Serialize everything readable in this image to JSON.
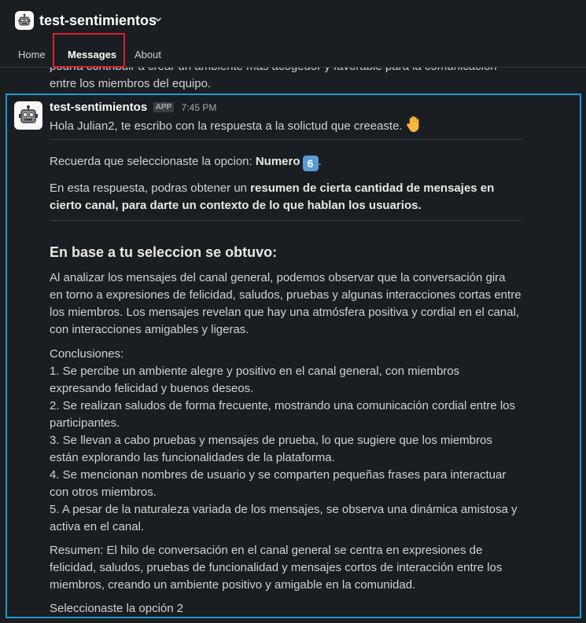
{
  "header": {
    "title": "test-sentimientos",
    "icons": {
      "app": "robot-icon",
      "dropdown": "chevron-down-icon"
    },
    "tabs": [
      {
        "label": "Home"
      },
      {
        "label": "Messages"
      },
      {
        "label": "About"
      }
    ],
    "active_tab": "Messages"
  },
  "colors": {
    "background": "#1a1d21",
    "selection_border": "#1d9bd1",
    "highlight_box": "#d8212b"
  },
  "previous_message": {
    "text": "podría contribuir a crear un ambiente más acogedor y favorable para la comunicación entre los miembros del equipo."
  },
  "message": {
    "sender": "test-sentimientos",
    "badge": "APP",
    "time": "7:45 PM",
    "avatar_icon": "robot-icon",
    "greeting": "Hola Julian2, te escribo con la respuesta a la solictud que creeaste.",
    "greeting_emoji": "raised-hand-icon",
    "option_prefix": "Recuerda que seleccionaste la opcion: ",
    "option_bold": "Numero",
    "option_emoji": "6",
    "option_suffix": ".",
    "desc_prefix": "En esta respuesta, podras obtener un ",
    "desc_bold": "resumen de cierta cantidad de mensajes en cierto canal, para darte un contexto de lo que hablan los usuarios.",
    "heading": "En base a tu seleccion se obtuvo:",
    "analysis": "Al analizar los mensajes del canal general, podemos observar que la conversación gira en torno a expresiones de felicidad, saludos, pruebas y algunas interacciones cortas entre los miembros. Los mensajes revelan que hay una atmósfera positiva y cordial en el canal, con interacciones amigables y ligeras.",
    "conclusions_title": "Conclusiones:",
    "conclusions": [
      "1. Se percibe un ambiente alegre y positivo en el canal general, con miembros expresando felicidad y buenos deseos.",
      "2. Se realizan saludos de forma frecuente, mostrando una comunicación cordial entre los participantes.",
      "3. Se llevan a cabo pruebas y mensajes de prueba, lo que sugiere que los miembros están explorando las funcionalidades de la plataforma.",
      "4. Se mencionan nombres de usuario y se comparten pequeñas frases para interactuar con otros miembros.",
      "5. A pesar de la naturaleza variada de los mensajes, se observa una dinámica amistosa y activa en el canal."
    ],
    "summary": "Resumen: El hilo de conversación en el canal general se centra en expresiones de felicidad, saludos, pruebas de funcionalidad y mensajes cortos de interacción entre los miembros, creando un ambiente positivo y amigable en la comunidad.",
    "footer": "Seleccionaste la opción 2"
  }
}
